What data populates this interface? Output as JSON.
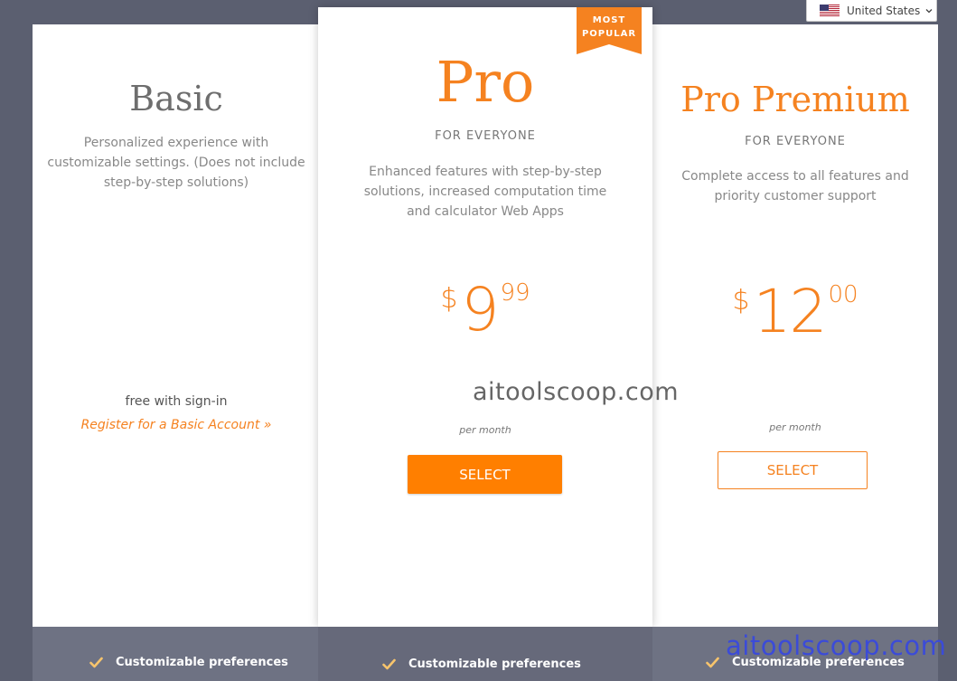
{
  "region": {
    "label": "United States",
    "icon": "us-flag-icon"
  },
  "basic": {
    "title": "Basic",
    "description_lines": [
      "Personalized experience with",
      "customizable settings. (Does not include",
      "step-by-step solutions)"
    ],
    "free_text": "free with sign-in",
    "register_link": "Register for a Basic Account »"
  },
  "pro": {
    "badge_line1": "MOST",
    "badge_line2": "POPULAR",
    "title": "Pro",
    "subtitle": "FOR EVERYONE",
    "description_lines": [
      "Enhanced features with step-by-step",
      "solutions, increased computation time",
      "and calculator Web Apps"
    ],
    "currency": "$",
    "price_whole": "9",
    "price_cents": "99",
    "period": "per month",
    "button": "SELECT"
  },
  "premium": {
    "title": "Pro Premium",
    "subtitle": "FOR EVERYONE",
    "description_lines": [
      "Complete access to all features and",
      "priority customer support"
    ],
    "currency": "$",
    "price_whole": "12",
    "price_cents": "00",
    "period": "per month",
    "button": "SELECT"
  },
  "features": {
    "basic": "Customizable preferences",
    "pro": "Customizable preferences",
    "premium": "Customizable preferences"
  },
  "watermarks": [
    "aitoolscoop.com",
    "aitoolscoop.com"
  ],
  "colors": {
    "accent": "#f58220",
    "button": "#ff7f00",
    "background": "#5b5f70",
    "check": "#f7c46c"
  }
}
